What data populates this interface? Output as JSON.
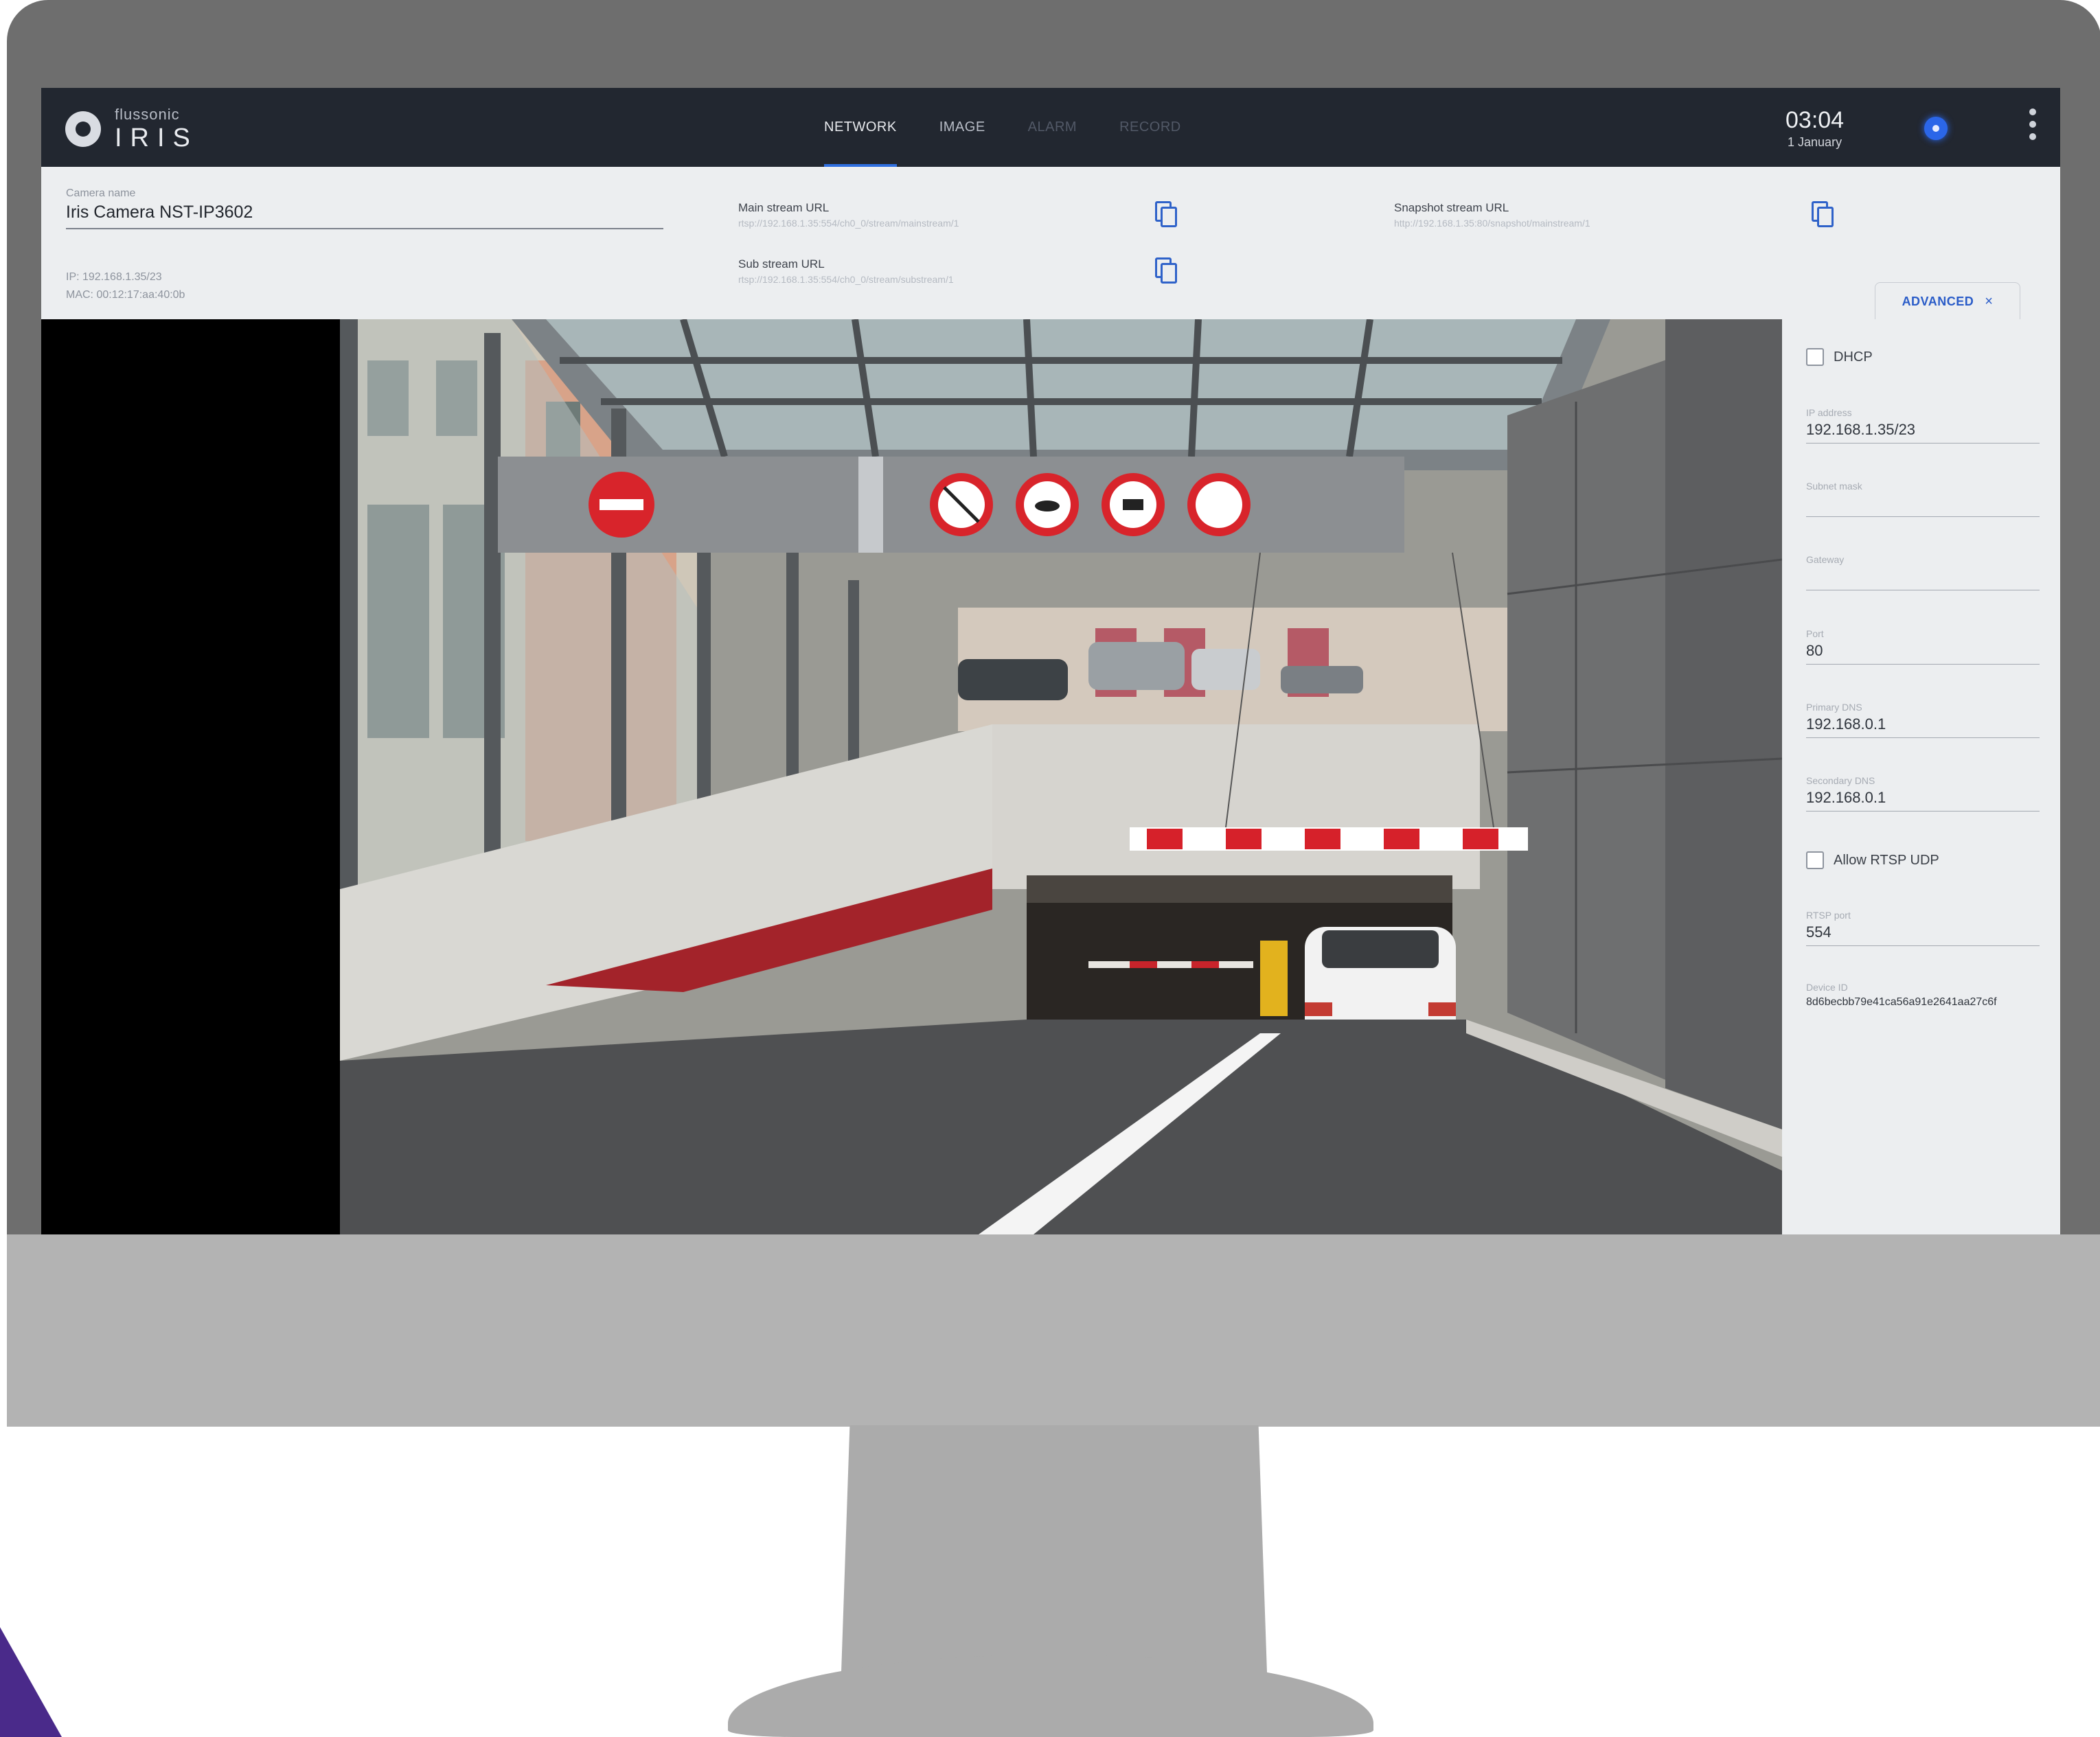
{
  "app": {
    "brand": "flussonic",
    "product": "IRIS"
  },
  "nav": {
    "tabs": [
      {
        "label": "NETWORK",
        "state": "active"
      },
      {
        "label": "IMAGE",
        "state": "normal"
      },
      {
        "label": "ALARM",
        "state": "disabled"
      },
      {
        "label": "RECORD",
        "state": "disabled"
      }
    ]
  },
  "clock": {
    "time": "03:04",
    "date": "1 January"
  },
  "icons": {
    "status": "status-indicator-icon",
    "menu": "kebab-menu-icon",
    "copy": "copy-icon",
    "logo": "iris-logo-icon"
  },
  "camera": {
    "name_label": "Camera name",
    "name": "Iris Camera NST-IP3602",
    "ip_line": "IP: 192.168.1.35/23",
    "mac_line": "MAC: 00:12:17:aa:40:0b"
  },
  "streams": {
    "main_label": "Main stream URL",
    "main_url": "rtsp://192.168.1.35:554/ch0_0/stream/mainstream/1",
    "sub_label": "Sub stream URL",
    "sub_url": "rtsp://192.168.1.35:554/ch0_0/stream/substream/1",
    "snapshot_label": "Snapshot stream URL",
    "snapshot_url": "http://192.168.1.35:80/snapshot/mainstream/1"
  },
  "advanced": {
    "tab_label": "ADVANCED",
    "close": "×",
    "dhcp_label": "DHCP",
    "dhcp_checked": false,
    "ip_label": "IP address",
    "ip_value": "192.168.1.35/23",
    "subnet_label": "Subnet mask",
    "subnet_value": "",
    "gateway_label": "Gateway",
    "gateway_value": "",
    "port_label": "Port",
    "port_value": "80",
    "dns1_label": "Primary DNS",
    "dns1_value": "192.168.0.1",
    "dns2_label": "Secondary DNS",
    "dns2_value": "192.168.0.1",
    "rtsp_udp_label": "Allow RTSP UDP",
    "rtsp_udp_checked": false,
    "rtsp_port_label": "RTSP port",
    "rtsp_port_value": "554",
    "device_id_label": "Device ID",
    "device_id_value": "8d6becbb79e41ca56a91e2641aa27c6f"
  },
  "colors": {
    "accent": "#2f6fe0",
    "topbar": "#222730",
    "panel": "#eceef0",
    "bezel": "#6e6e6e",
    "stand": "#b3b3b3"
  }
}
